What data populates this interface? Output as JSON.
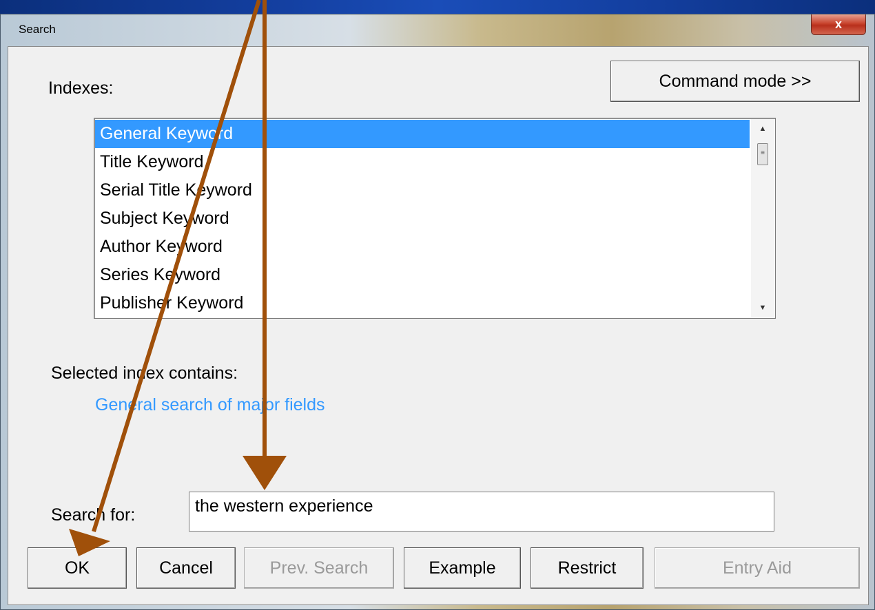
{
  "window": {
    "title": "Search",
    "close_label": "x"
  },
  "indexes_label": "Indexes:",
  "command_mode_label": "Command mode >>",
  "index_list": [
    "General Keyword",
    "Title Keyword",
    "Serial Title Keyword",
    "Subject Keyword",
    "Author Keyword",
    "Series Keyword",
    "Publisher Keyword"
  ],
  "selected_index": "General Keyword",
  "selected_index_label": "Selected index contains:",
  "selected_index_description": "General search of major fields",
  "search": {
    "label": "Search for:",
    "value": "the western experience"
  },
  "buttons": {
    "ok": "OK",
    "cancel": "Cancel",
    "prev_search": "Prev. Search",
    "example": "Example",
    "restrict": "Restrict",
    "entry_aid": "Entry Aid"
  },
  "annotation_arrow_color": "#a0500a",
  "selection_color": "#3399ff"
}
